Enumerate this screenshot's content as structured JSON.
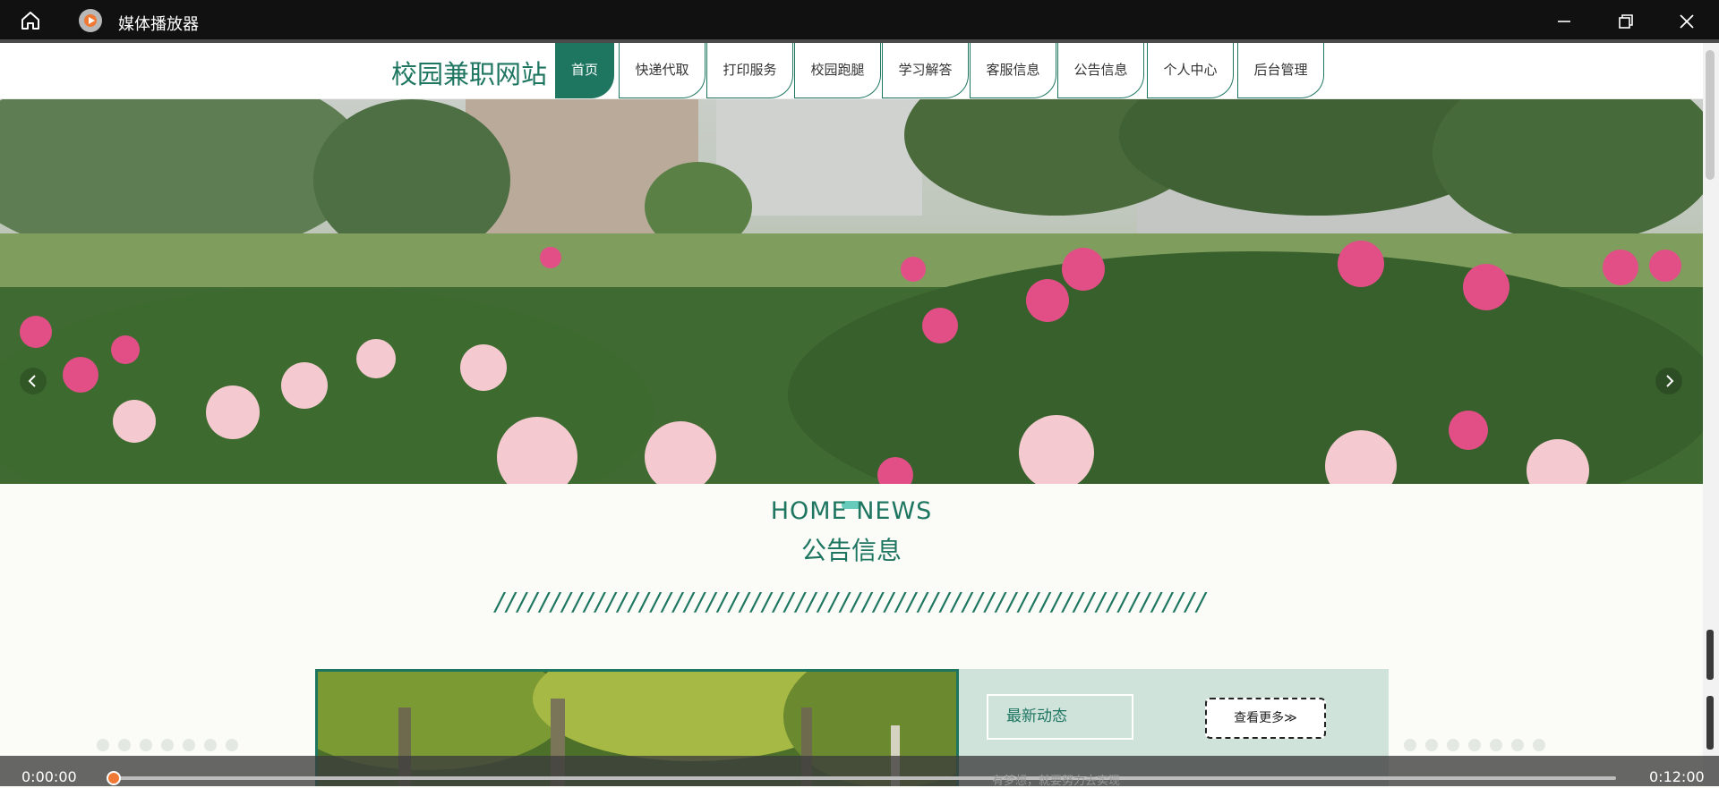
{
  "window": {
    "app_title": "媒体播放器"
  },
  "site": {
    "brand": "校园兼职网站",
    "nav": [
      "首页",
      "快递代取",
      "打印服务",
      "校园跑腿",
      "学习解答",
      "客服信息",
      "公告信息",
      "个人中心",
      "后台管理"
    ]
  },
  "news": {
    "heading_en": "HOME NEWS",
    "heading_cn": "公告信息",
    "divider": "////////////////////////////////////////////////////////////////",
    "latest_label": "最新动态",
    "more_label": "查看更多≫",
    "partial_item": "有梦想，就要努力去实现"
  },
  "player": {
    "current_time": "0:00:00",
    "total_time": "0:12:00",
    "progress": 0
  },
  "colors": {
    "accent": "#1e7661",
    "panel": "#cfe3da",
    "seek_knob": "#f07a35"
  },
  "icons": {
    "home": "home-icon",
    "min": "minimize-icon",
    "max": "restore-icon",
    "close": "close-icon"
  }
}
